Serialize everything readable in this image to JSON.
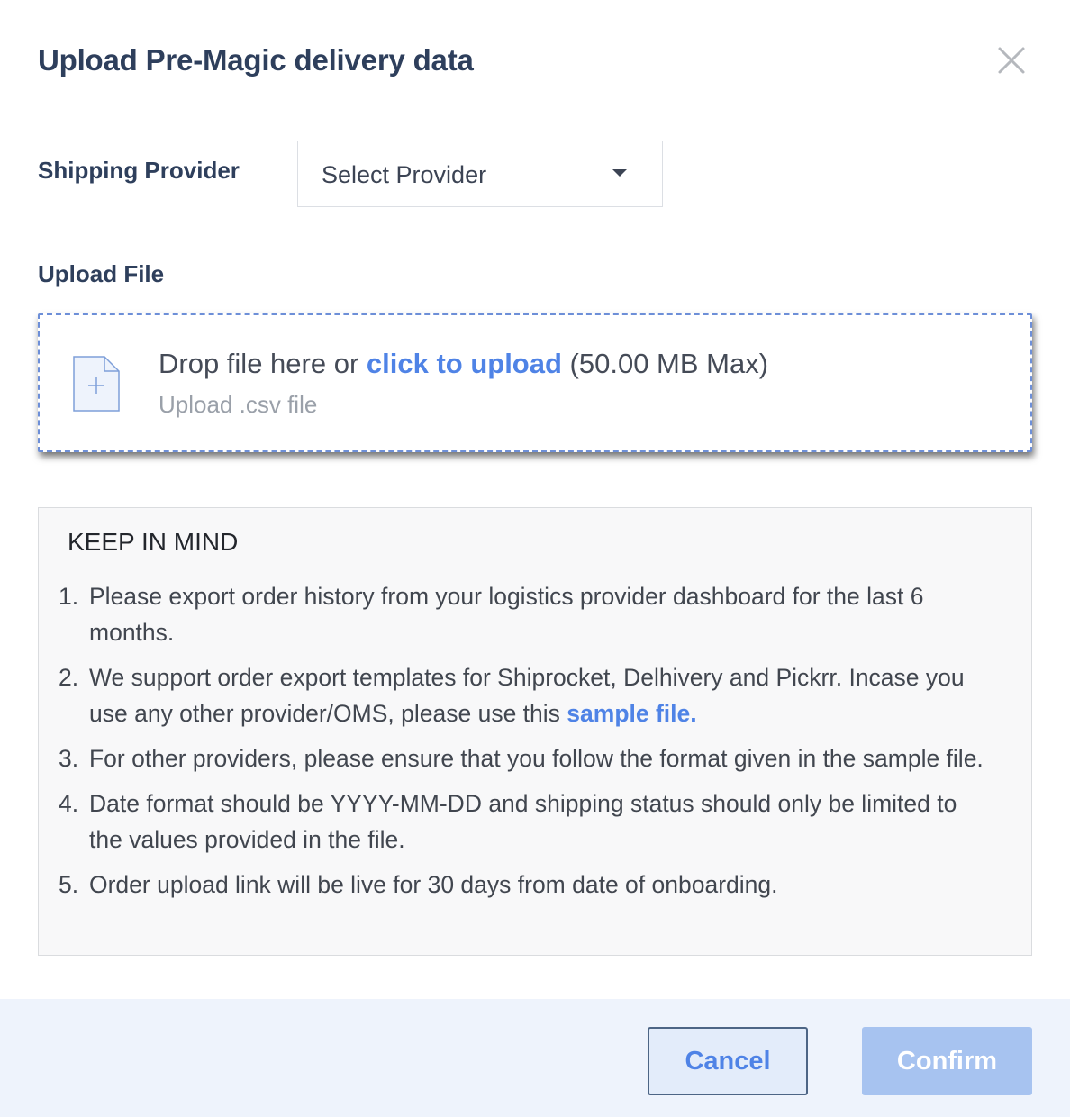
{
  "modal": {
    "title": "Upload Pre-Magic delivery data"
  },
  "shipping_provider": {
    "label": "Shipping Provider",
    "select_value": "Select Provider"
  },
  "upload": {
    "label": "Upload File",
    "drop_prefix": "Drop file here or ",
    "drop_link": "click to upload",
    "drop_suffix": " (50.00 MB Max)",
    "sub_text": "Upload .csv file"
  },
  "keep_in_mind": {
    "title": "KEEP IN MIND",
    "items": [
      {
        "num": "1.",
        "text": "Please export order history from your logistics provider dashboard for the last 6 months."
      },
      {
        "num": "2.",
        "text_before": "We support order export templates for Shiprocket, Delhivery and Pickrr. Incase you use any other provider/OMS, please use this ",
        "link": "sample file."
      },
      {
        "num": "3.",
        "text": "For other providers, please ensure that you follow the format given in the sample file."
      },
      {
        "num": "4.",
        "text": "Date format should be YYYY-MM-DD and shipping status should only be limited to the values provided in the file."
      },
      {
        "num": "5.",
        "text": "Order upload link will be live for 30 days from date of onboarding."
      }
    ]
  },
  "footer": {
    "cancel_label": "Cancel",
    "confirm_label": "Confirm"
  },
  "icons": {
    "close": "close-icon",
    "caret": "caret-down-icon",
    "file": "file-plus-icon"
  },
  "colors": {
    "title": "#2e3f5c",
    "link": "#4f83e6",
    "footer_bg": "#eef3fc",
    "confirm_disabled": "#a7c3f0"
  }
}
